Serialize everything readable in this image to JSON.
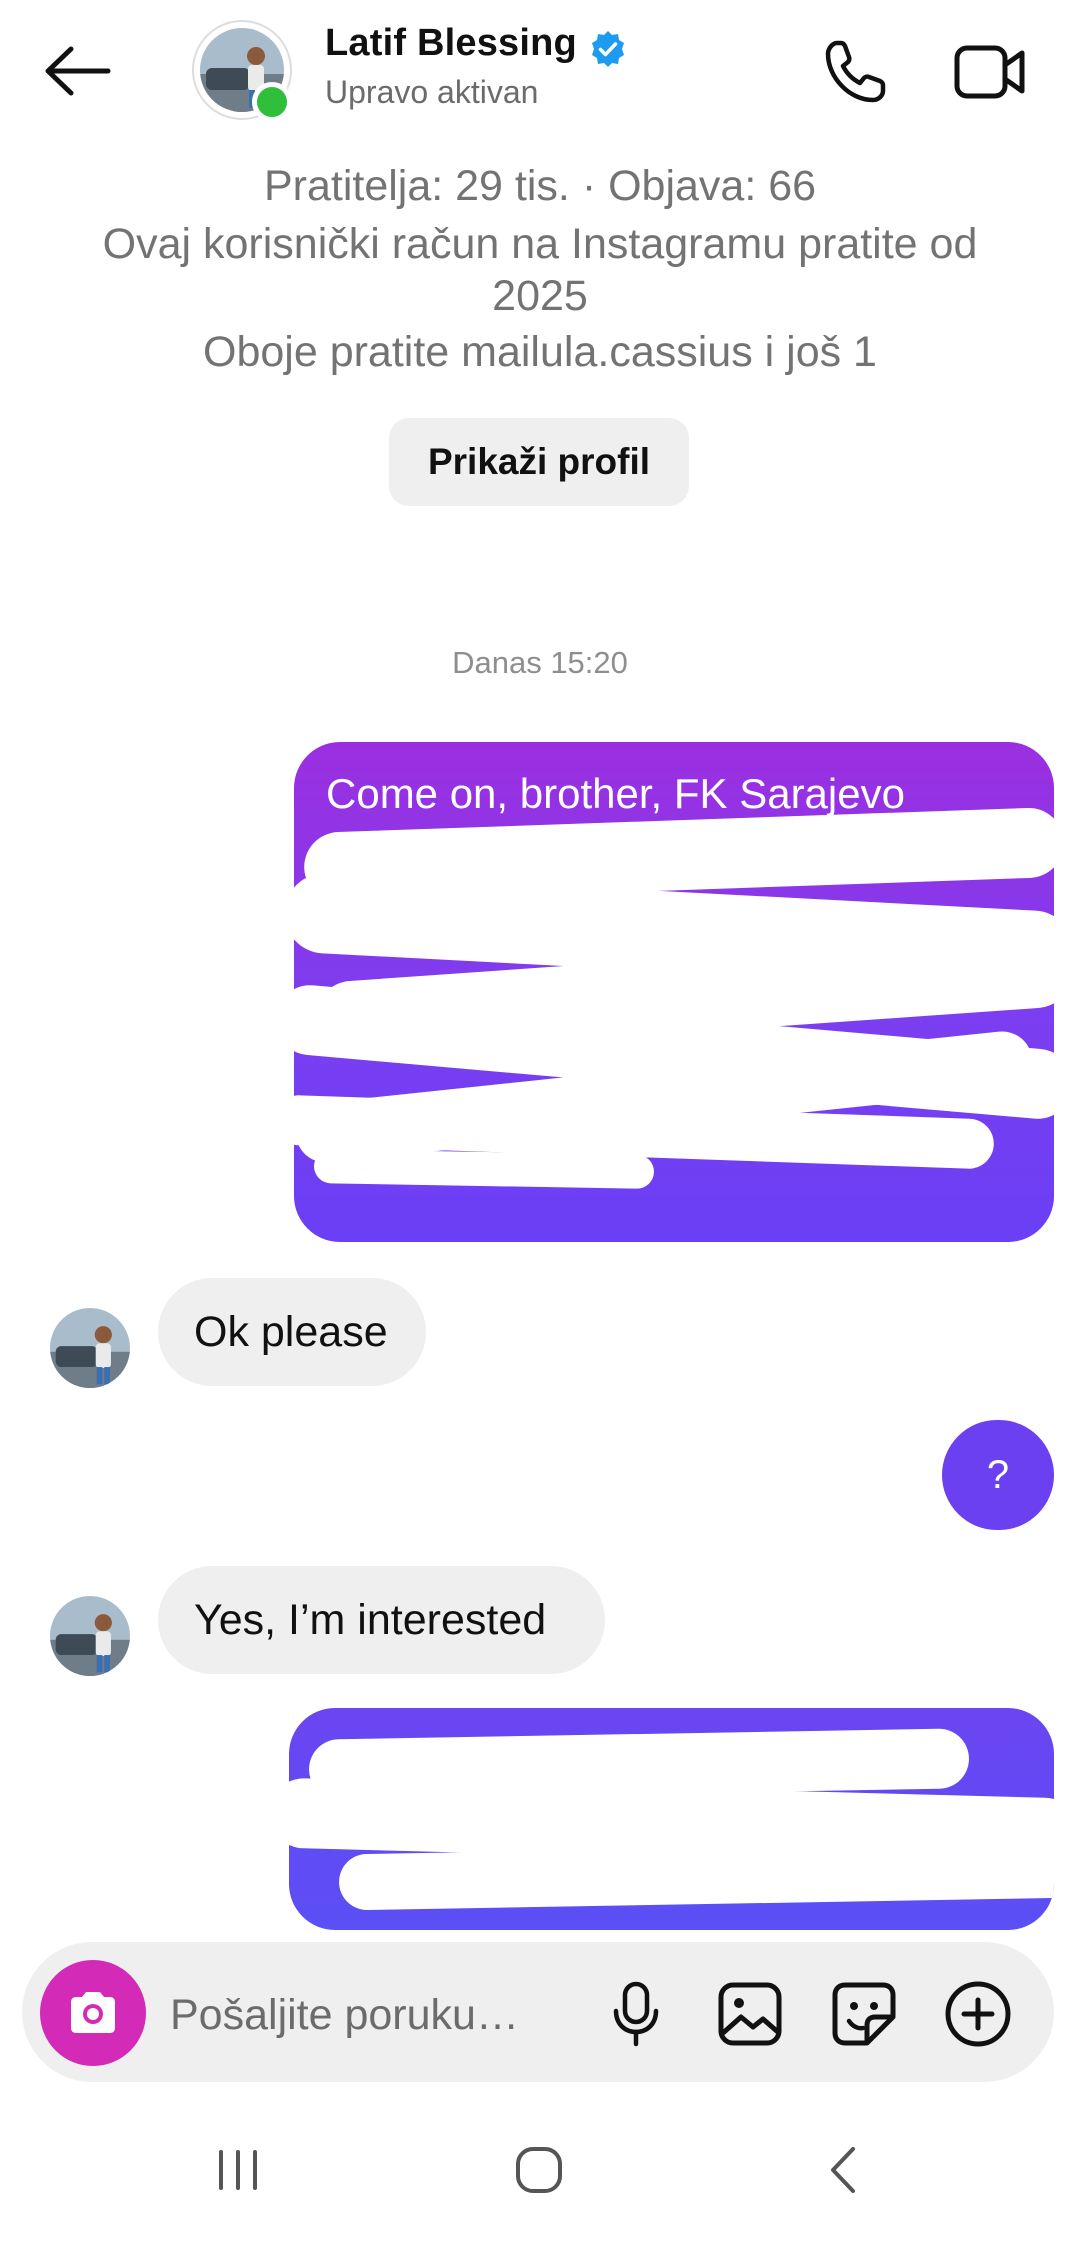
{
  "header": {
    "name": "Latif Blessing",
    "status": "Upravo aktivan",
    "verified": true
  },
  "profile": {
    "stats": "Pratitelja: 29 tis. · Objava: 66",
    "following_since_line1": "Ovaj korisnički račun na Instagramu pratite od",
    "following_since_line2": "2025",
    "mutual": "Oboje pratite mailula.cassius i još 1",
    "view_profile_label": "Prikaži profil"
  },
  "chat": {
    "timestamp": "Danas 15:20",
    "messages": [
      {
        "from": "me",
        "text": "Come on, brother, FK Sarajevo",
        "redacted": true
      },
      {
        "from": "them",
        "text": "Ok please"
      },
      {
        "from": "me",
        "text": "?"
      },
      {
        "from": "them",
        "text": "Yes, I’m interested"
      },
      {
        "from": "me",
        "text": "",
        "redacted": true
      }
    ]
  },
  "composer": {
    "placeholder": "Pošaljite poruku…"
  },
  "colors": {
    "outgoing_top": "#9b2fe0",
    "outgoing_bottom": "#6a3ff5",
    "incoming": "#efefef",
    "camera": "#d42ab8",
    "online": "#2fbf3a",
    "verified": "#1d9bf0"
  },
  "icons": [
    "back-arrow-icon",
    "phone-icon",
    "video-camera-icon",
    "camera-icon",
    "microphone-icon",
    "gallery-icon",
    "sticker-icon",
    "plus-circle-icon",
    "recents-icon",
    "home-icon",
    "nav-back-icon"
  ]
}
